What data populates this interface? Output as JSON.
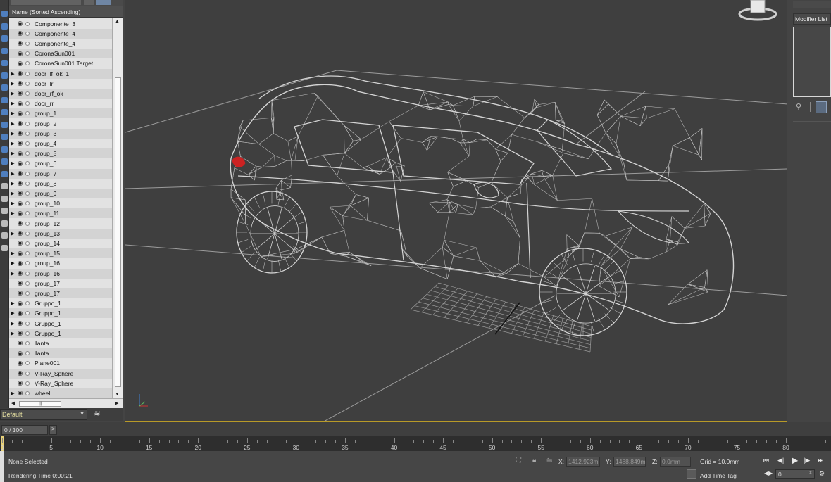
{
  "explorer": {
    "header": "Name (Sorted Ascending)",
    "rows": [
      {
        "name": "Componente_3",
        "expand": false,
        "icon": "eye"
      },
      {
        "name": "Componente_4",
        "expand": false,
        "icon": "eye"
      },
      {
        "name": "Componente_4",
        "expand": false,
        "icon": "eye"
      },
      {
        "name": "CoronaSun001",
        "expand": false,
        "icon": "light"
      },
      {
        "name": "CoronaSun001.Target",
        "expand": false,
        "icon": "light"
      },
      {
        "name": "door_lf_ok_1",
        "expand": true,
        "icon": "eye"
      },
      {
        "name": "door_lr",
        "expand": true,
        "icon": "eye"
      },
      {
        "name": "door_rf_ok",
        "expand": true,
        "icon": "eye"
      },
      {
        "name": "door_rr",
        "expand": true,
        "icon": "eye"
      },
      {
        "name": "group_1",
        "expand": true,
        "icon": "eye"
      },
      {
        "name": "group_2",
        "expand": true,
        "icon": "eye"
      },
      {
        "name": "group_3",
        "expand": true,
        "icon": "eye"
      },
      {
        "name": "group_4",
        "expand": true,
        "icon": "eye"
      },
      {
        "name": "group_5",
        "expand": true,
        "icon": "eye"
      },
      {
        "name": "group_6",
        "expand": true,
        "icon": "eye"
      },
      {
        "name": "group_7",
        "expand": true,
        "icon": "eye"
      },
      {
        "name": "group_8",
        "expand": true,
        "icon": "eye"
      },
      {
        "name": "group_9",
        "expand": true,
        "icon": "eye"
      },
      {
        "name": "group_10",
        "expand": true,
        "icon": "eye"
      },
      {
        "name": "group_11",
        "expand": true,
        "icon": "eye"
      },
      {
        "name": "group_12",
        "expand": false,
        "icon": "eye"
      },
      {
        "name": "group_13",
        "expand": true,
        "icon": "eye"
      },
      {
        "name": "group_14",
        "expand": false,
        "icon": "eye"
      },
      {
        "name": "group_15",
        "expand": true,
        "icon": "eye"
      },
      {
        "name": "group_16",
        "expand": true,
        "icon": "eye"
      },
      {
        "name": "group_16",
        "expand": true,
        "icon": "eye"
      },
      {
        "name": "group_17",
        "expand": false,
        "icon": "eye"
      },
      {
        "name": "group_17",
        "expand": false,
        "icon": "eye"
      },
      {
        "name": "Gruppo_1",
        "expand": true,
        "icon": "eye"
      },
      {
        "name": "Gruppo_1",
        "expand": true,
        "icon": "eye"
      },
      {
        "name": "Gruppo_1",
        "expand": true,
        "icon": "eye"
      },
      {
        "name": "Gruppo_1",
        "expand": true,
        "icon": "eye"
      },
      {
        "name": "llanta",
        "expand": false,
        "icon": "eye"
      },
      {
        "name": "llanta",
        "expand": false,
        "icon": "eye"
      },
      {
        "name": "Plane001",
        "expand": false,
        "icon": "eye"
      },
      {
        "name": "V-Ray_Sphere",
        "expand": false,
        "icon": "eye"
      },
      {
        "name": "V-Ray_Sphere",
        "expand": false,
        "icon": "eye"
      },
      {
        "name": "wheel",
        "expand": true,
        "icon": "eye"
      }
    ]
  },
  "layer": {
    "value": "Default"
  },
  "right_panel": {
    "modifier_list": "Modifier List"
  },
  "timeline": {
    "position": "0 / 100",
    "next": ">",
    "current_frame": 0,
    "max_frame": 100,
    "labels": [
      "0",
      "5",
      "10",
      "15",
      "20",
      "25",
      "30",
      "35",
      "40",
      "45",
      "50",
      "55",
      "60",
      "65",
      "70",
      "75",
      "80"
    ]
  },
  "status": {
    "selection": "None Selected",
    "render_time": "Rendering Time  0:00:21",
    "x_label": "X:",
    "x_value": "1412,923m",
    "y_label": "Y:",
    "y_value": "1488,849m",
    "z_label": "Z:",
    "z_value": "0,0mm",
    "grid": "Grid = 10,0mm",
    "add_time_tag": "Add Time Tag",
    "frame_field": "0"
  },
  "colors": {
    "viewport_bg": "#3f3f3f",
    "viewport_border": "#b89a28",
    "wire": "#d9d9d9",
    "layer_text": "#e8e2a2",
    "time_marker": "#e9d27a",
    "selected_mesh": "#cc2222"
  }
}
